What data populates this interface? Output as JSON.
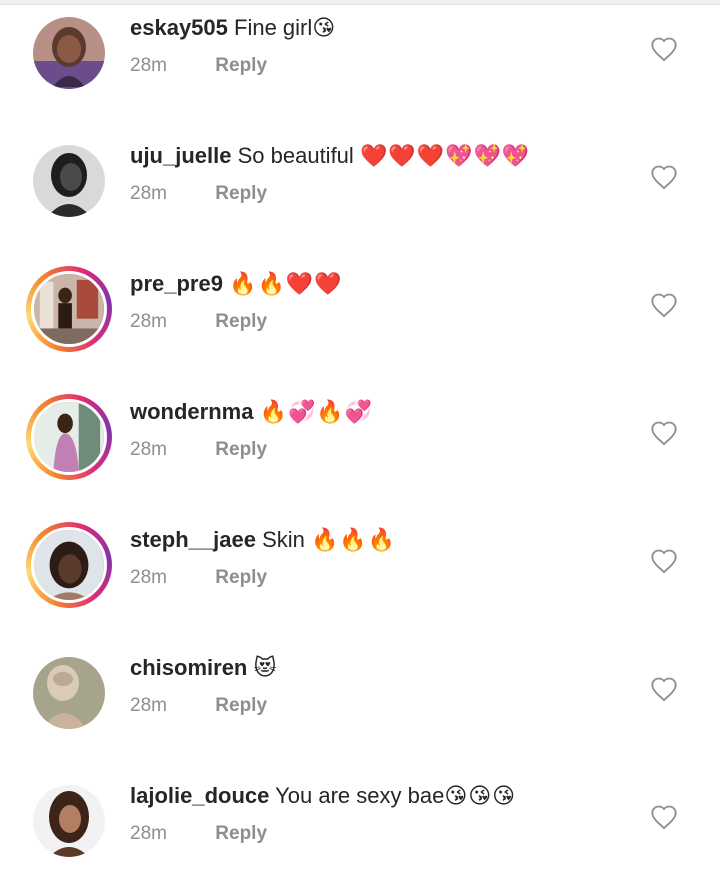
{
  "comments": [
    {
      "username": "eskay505",
      "text": "Fine girl",
      "emojis": "😘",
      "time": "28m",
      "reply_label": "Reply",
      "story_ring": false,
      "avatar_icon": "profile-photo",
      "like_icon": "heart-outline-icon"
    },
    {
      "username": "uju_juelle",
      "text": "So beautiful",
      "emojis": "❤️❤️❤️💖💖💖",
      "time": "28m",
      "reply_label": "Reply",
      "story_ring": false,
      "avatar_icon": "profile-photo",
      "like_icon": "heart-outline-icon"
    },
    {
      "username": "pre_pre9",
      "text": "",
      "emojis": "🔥🔥❤️❤️",
      "time": "28m",
      "reply_label": "Reply",
      "story_ring": true,
      "avatar_icon": "profile-photo",
      "like_icon": "heart-outline-icon"
    },
    {
      "username": "wondernma",
      "text": "",
      "emojis": "🔥💞🔥💞",
      "time": "28m",
      "reply_label": "Reply",
      "story_ring": true,
      "avatar_icon": "profile-photo",
      "like_icon": "heart-outline-icon"
    },
    {
      "username": "steph__jaee",
      "text": "Skin",
      "emojis": "🔥🔥🔥",
      "time": "28m",
      "reply_label": "Reply",
      "story_ring": true,
      "avatar_icon": "profile-photo",
      "like_icon": "heart-outline-icon"
    },
    {
      "username": "chisomiren",
      "text": "",
      "emojis": "😻",
      "time": "28m",
      "reply_label": "Reply",
      "story_ring": false,
      "avatar_icon": "profile-photo",
      "like_icon": "heart-outline-icon"
    },
    {
      "username": "lajolie_douce",
      "text": "You are sexy bae",
      "emojis": "😘😘😘",
      "time": "28m",
      "reply_label": "Reply",
      "story_ring": false,
      "avatar_icon": "profile-photo",
      "like_icon": "heart-outline-icon"
    }
  ],
  "colors": {
    "text_primary": "#262626",
    "text_secondary": "#8e8e8e",
    "story_ring_start": "#f58529",
    "story_ring_end": "#8134af"
  }
}
